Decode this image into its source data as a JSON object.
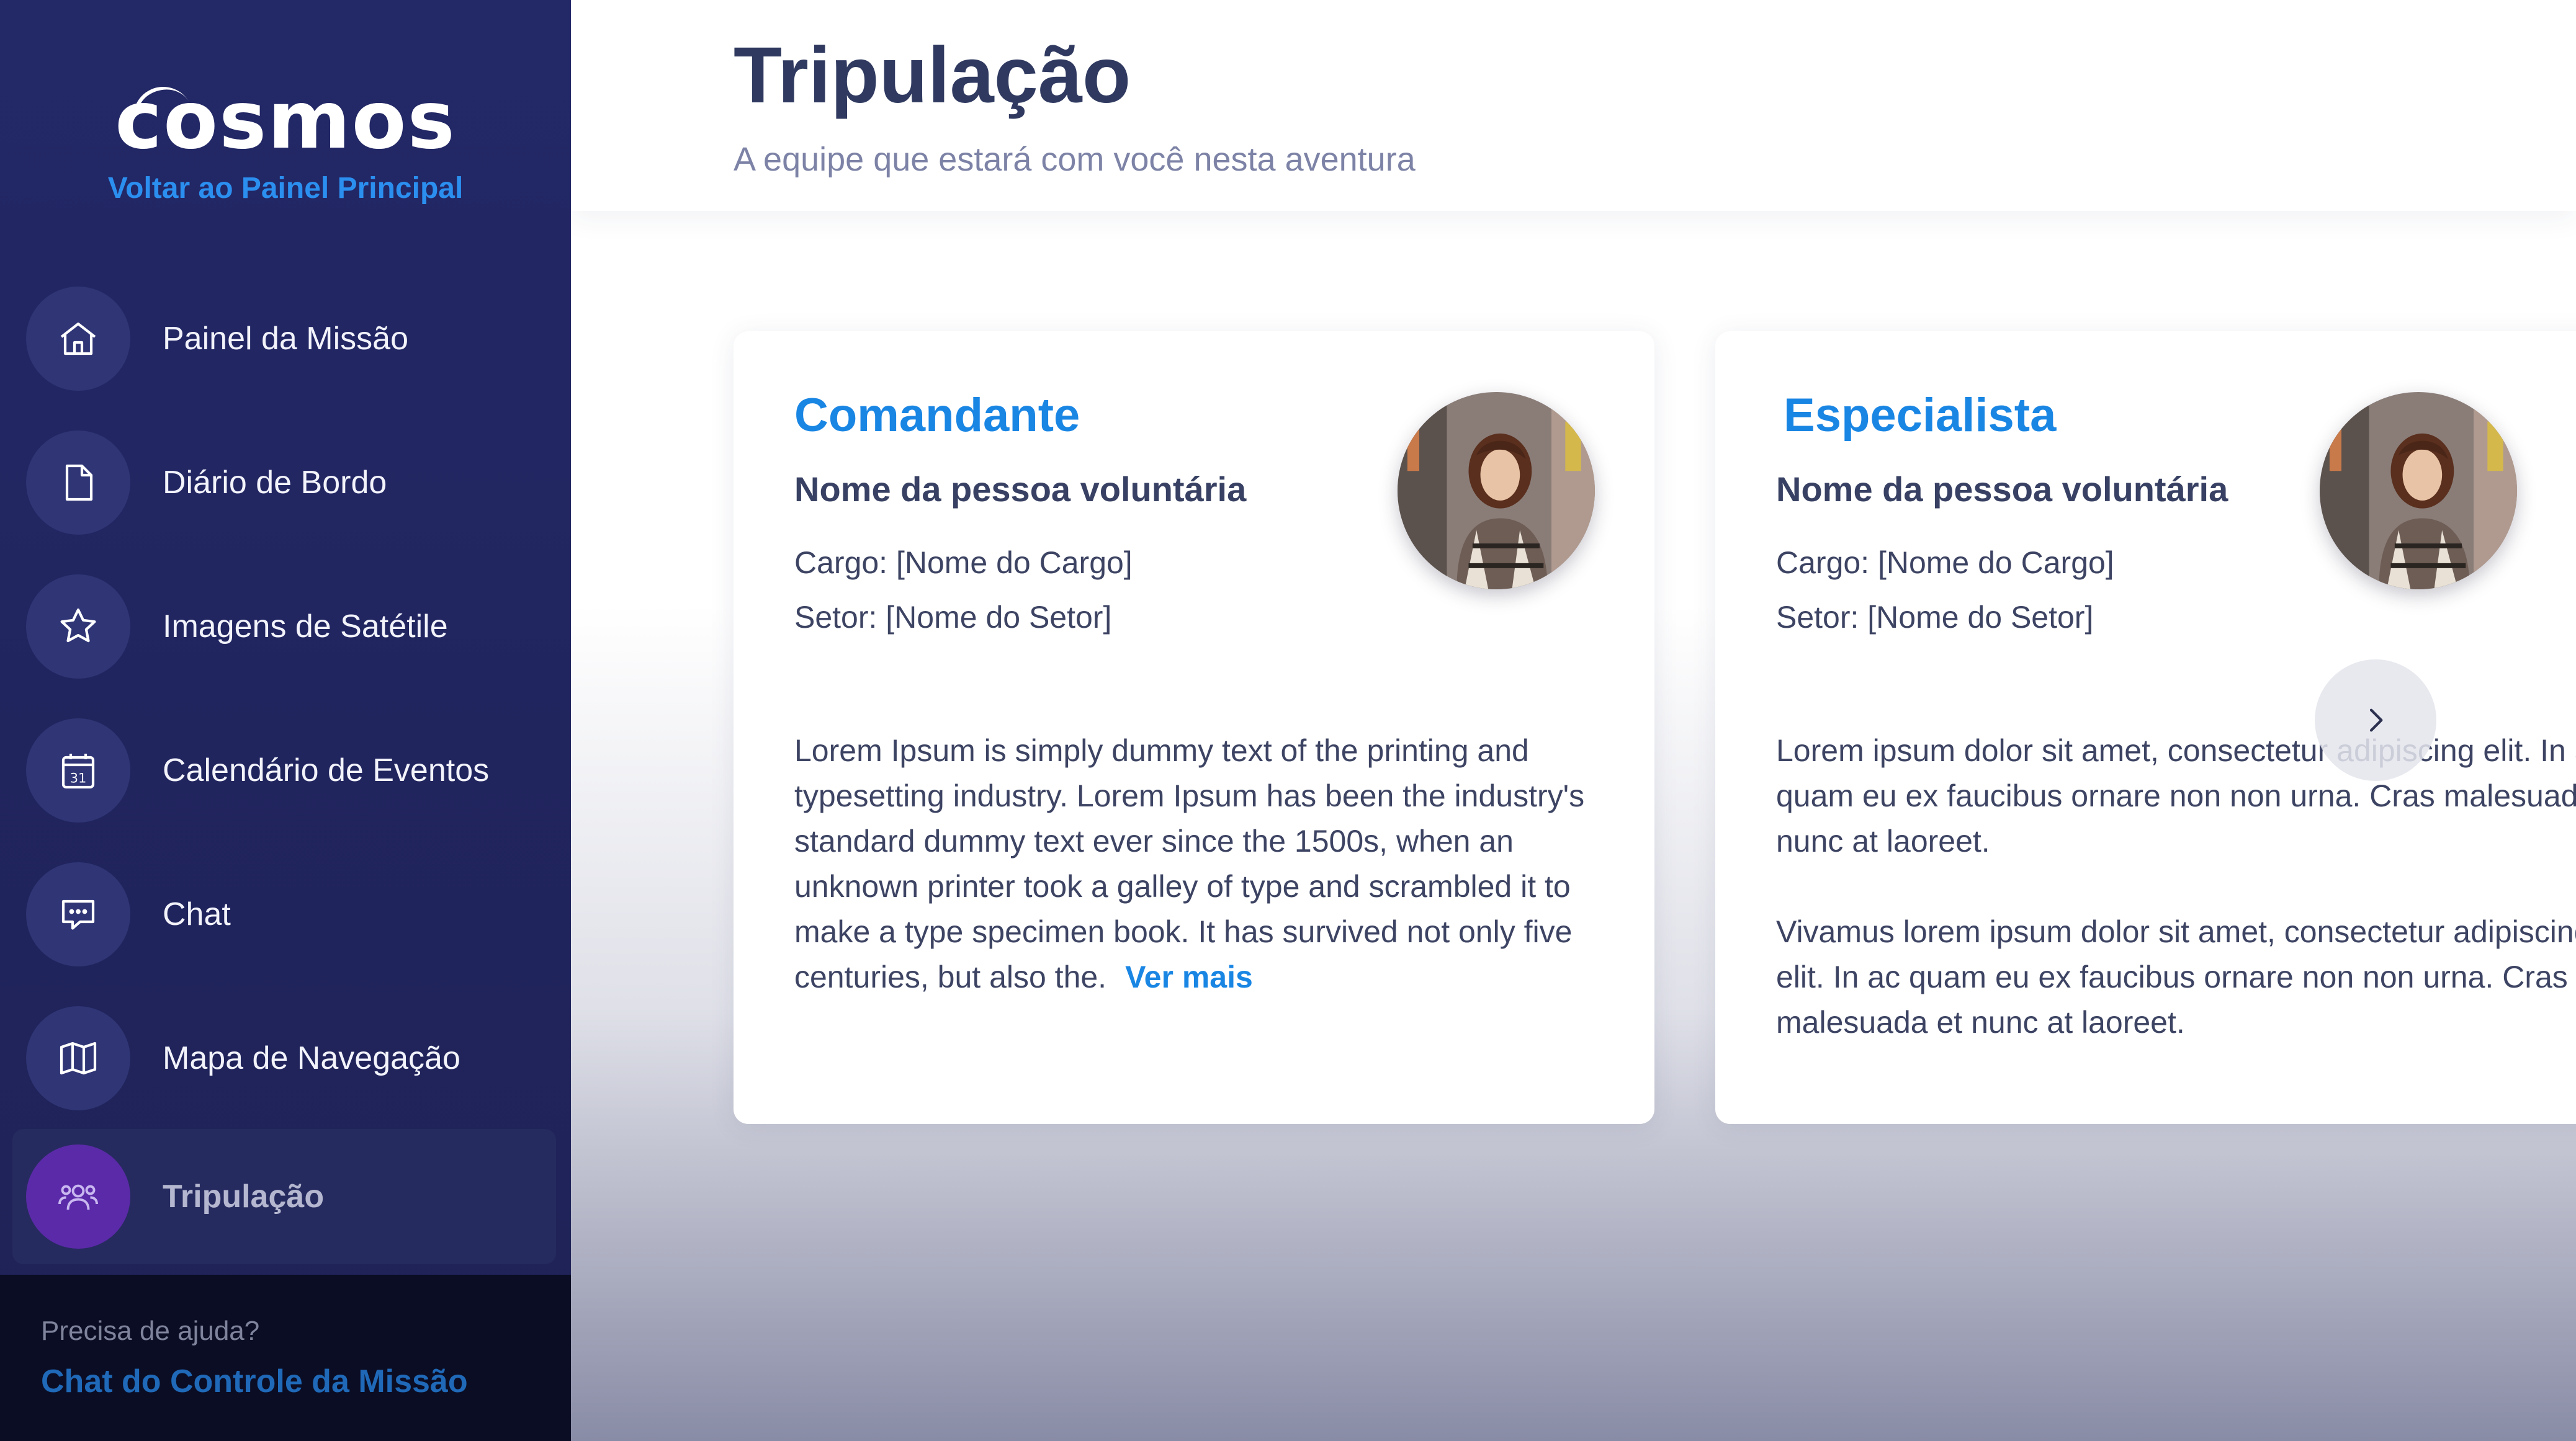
{
  "sidebar": {
    "logo_text": "cosmos",
    "back_link": "Voltar ao Painel Principal",
    "items": [
      {
        "label": "Painel da Missão",
        "icon": "home-icon"
      },
      {
        "label": "Diário de Bordo",
        "icon": "document-icon"
      },
      {
        "label": "Imagens de Satétile",
        "icon": "star-icon"
      },
      {
        "label": "Calendário de Eventos",
        "icon": "calendar-icon"
      },
      {
        "label": "Chat",
        "icon": "chat-icon"
      },
      {
        "label": "Mapa de Navegação",
        "icon": "map-icon"
      },
      {
        "label": "Tripulação",
        "icon": "users-icon",
        "active": true
      }
    ],
    "calendar_day": "31",
    "help_question": "Precisa de ajuda?",
    "help_link": "Chat do Controle da Missão",
    "collapse_icon": "arrow-left-icon"
  },
  "header": {
    "title": "Tripulação",
    "subtitle": "A equipe que estará com você nesta aventura"
  },
  "cards": [
    {
      "role": "Comandante",
      "name": "Nome da pessoa voluntária",
      "cargo": "Cargo: [Nome do Cargo]",
      "setor": "Setor: [Nome do Setor]",
      "bio": "Lorem Ipsum is simply dummy text of the printing and typesetting industry. Lorem Ipsum has been the industry's standard dummy text ever since the 1500s, when an unknown printer took a galley of type and scrambled it to make a type specimen book. It has survived not only five centuries, but also the.",
      "see_more": "Ver mais"
    },
    {
      "role": "Especialista",
      "name": "Nome da pessoa voluntária",
      "cargo": "Cargo: [Nome do Cargo]",
      "setor": "Setor: [Nome do Setor]",
      "bio_p1": "Lorem ipsum dolor sit amet, consectetur adipiscing elit. In ac quam eu ex faucibus ornare non non urna. Cras malesuada et nunc at laoreet.",
      "bio_p2": "Vivamus lorem ipsum dolor sit amet, consectetur adipiscing elit. In ac quam eu ex faucibus ornare non non urna. Cras malesuada et nunc at laoreet."
    }
  ],
  "carousel": {
    "next_icon": "chevron-right-icon"
  },
  "colors": {
    "sidebar_bg": "#232867",
    "accent_blue": "#1a86e4",
    "active_purple": "#5b2aa8",
    "title_text": "#303a60"
  }
}
